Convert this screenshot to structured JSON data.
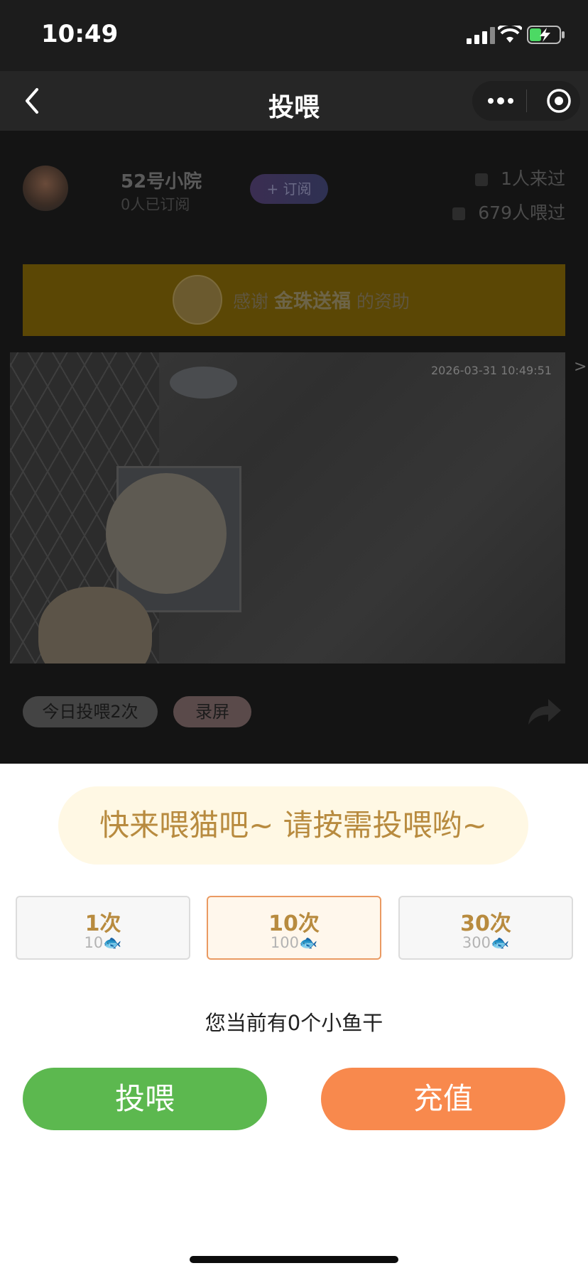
{
  "status_bar": {
    "time": "10:49"
  },
  "navbar": {
    "title": "投喂"
  },
  "station": {
    "name": "52号小院",
    "subscribers": "0人已订阅",
    "subscribe_label": "+ 订阅",
    "visitors": "1人来过",
    "feeders": "679人喂过"
  },
  "banner": {
    "prefix": "感谢",
    "sponsor": "金珠送福",
    "suffix": "的资助"
  },
  "video": {
    "timestamp": "2026-03-31 10:49:51",
    "next_arrow": ">"
  },
  "actions": {
    "today_feed": "今日投喂2次",
    "record": "录屏"
  },
  "sheet": {
    "hint": "快来喂猫吧~ 请按需投喂哟~",
    "options": [
      {
        "count": "1次",
        "cost": "10",
        "selected": false
      },
      {
        "count": "10次",
        "cost": "100",
        "selected": true
      },
      {
        "count": "30次",
        "cost": "300",
        "selected": false
      }
    ],
    "fish_icon": "🐟",
    "balance": "您当前有0个小鱼干",
    "feed_button": "投喂",
    "recharge_button": "充值"
  },
  "colors": {
    "accent_gold": "#b88b3f",
    "feed_green": "#5cb84f",
    "recharge_orange": "#f8894d",
    "selected_border": "#ea9a62"
  }
}
